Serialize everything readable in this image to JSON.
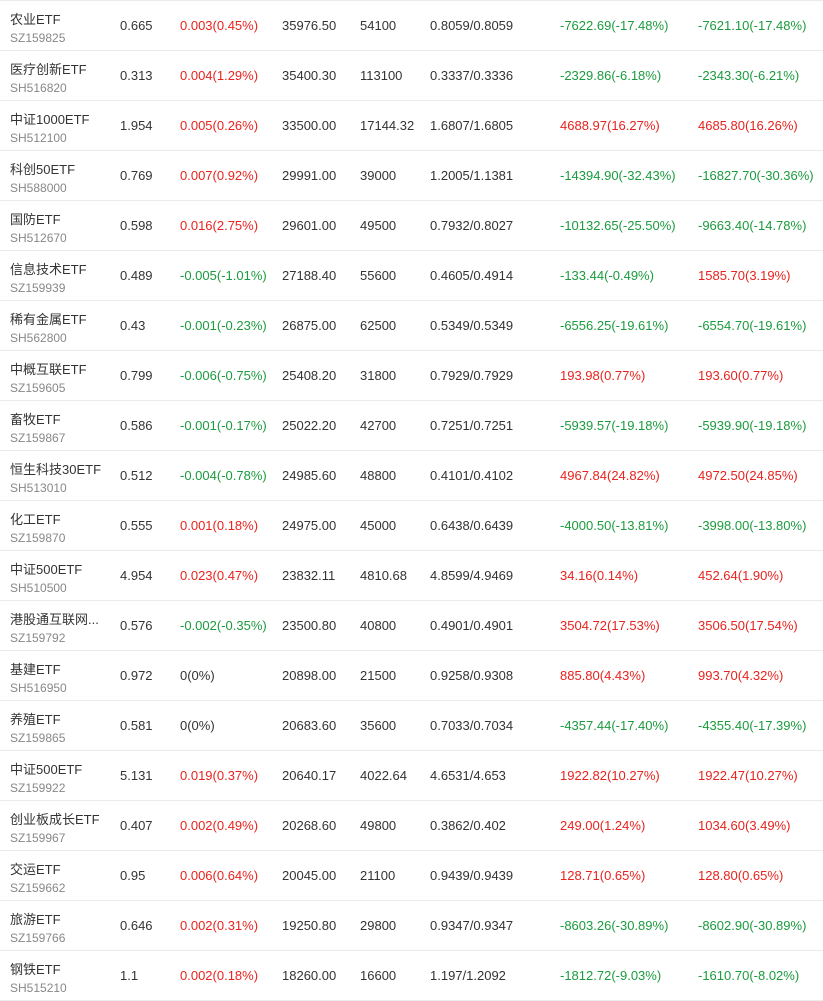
{
  "colors": {
    "up": "#e8231e",
    "down": "#1b9b3e",
    "flat": "#333333",
    "divider": "#ebebeb",
    "code": "#888888"
  },
  "rows": [
    {
      "name": "农业ETF",
      "code": "SZ159825",
      "price": "0.665",
      "change": "0.003(0.45%)",
      "dir": "up",
      "amount": "35976.50",
      "volume": "54100",
      "bid_ask": "0.8059/0.8059",
      "pl1": "-7622.69(-17.48%)",
      "pl1_dir": "down",
      "pl2": "-7621.10(-17.48%)",
      "pl2_dir": "down"
    },
    {
      "name": "医疗创新ETF",
      "code": "SH516820",
      "price": "0.313",
      "change": "0.004(1.29%)",
      "dir": "up",
      "amount": "35400.30",
      "volume": "113100",
      "bid_ask": "0.3337/0.3336",
      "pl1": "-2329.86(-6.18%)",
      "pl1_dir": "down",
      "pl2": "-2343.30(-6.21%)",
      "pl2_dir": "down"
    },
    {
      "name": "中证1000ETF",
      "code": "SH512100",
      "price": "1.954",
      "change": "0.005(0.26%)",
      "dir": "up",
      "amount": "33500.00",
      "volume": "17144.32",
      "bid_ask": "1.6807/1.6805",
      "pl1": "4688.97(16.27%)",
      "pl1_dir": "up",
      "pl2": "4685.80(16.26%)",
      "pl2_dir": "up"
    },
    {
      "name": "科创50ETF",
      "code": "SH588000",
      "price": "0.769",
      "change": "0.007(0.92%)",
      "dir": "up",
      "amount": "29991.00",
      "volume": "39000",
      "bid_ask": "1.2005/1.1381",
      "pl1": "-14394.90(-32.43%)",
      "pl1_dir": "down",
      "pl2": "-16827.70(-30.36%)",
      "pl2_dir": "down"
    },
    {
      "name": "国防ETF",
      "code": "SH512670",
      "price": "0.598",
      "change": "0.016(2.75%)",
      "dir": "up",
      "amount": "29601.00",
      "volume": "49500",
      "bid_ask": "0.7932/0.8027",
      "pl1": "-10132.65(-25.50%)",
      "pl1_dir": "down",
      "pl2": "-9663.40(-14.78%)",
      "pl2_dir": "down"
    },
    {
      "name": "信息技术ETF",
      "code": "SZ159939",
      "price": "0.489",
      "change": "-0.005(-1.01%)",
      "dir": "down",
      "amount": "27188.40",
      "volume": "55600",
      "bid_ask": "0.4605/0.4914",
      "pl1": "-133.44(-0.49%)",
      "pl1_dir": "down",
      "pl2": "1585.70(3.19%)",
      "pl2_dir": "up"
    },
    {
      "name": "稀有金属ETF",
      "code": "SH562800",
      "price": "0.43",
      "change": "-0.001(-0.23%)",
      "dir": "down",
      "amount": "26875.00",
      "volume": "62500",
      "bid_ask": "0.5349/0.5349",
      "pl1": "-6556.25(-19.61%)",
      "pl1_dir": "down",
      "pl2": "-6554.70(-19.61%)",
      "pl2_dir": "down"
    },
    {
      "name": "中概互联ETF",
      "code": "SZ159605",
      "price": "0.799",
      "change": "-0.006(-0.75%)",
      "dir": "down",
      "amount": "25408.20",
      "volume": "31800",
      "bid_ask": "0.7929/0.7929",
      "pl1": "193.98(0.77%)",
      "pl1_dir": "up",
      "pl2": "193.60(0.77%)",
      "pl2_dir": "up"
    },
    {
      "name": "畜牧ETF",
      "code": "SZ159867",
      "price": "0.586",
      "change": "-0.001(-0.17%)",
      "dir": "down",
      "amount": "25022.20",
      "volume": "42700",
      "bid_ask": "0.7251/0.7251",
      "pl1": "-5939.57(-19.18%)",
      "pl1_dir": "down",
      "pl2": "-5939.90(-19.18%)",
      "pl2_dir": "down"
    },
    {
      "name": "恒生科技30ETF",
      "code": "SH513010",
      "price": "0.512",
      "change": "-0.004(-0.78%)",
      "dir": "down",
      "amount": "24985.60",
      "volume": "48800",
      "bid_ask": "0.4101/0.4102",
      "pl1": "4967.84(24.82%)",
      "pl1_dir": "up",
      "pl2": "4972.50(24.85%)",
      "pl2_dir": "up"
    },
    {
      "name": "化工ETF",
      "code": "SZ159870",
      "price": "0.555",
      "change": "0.001(0.18%)",
      "dir": "up",
      "amount": "24975.00",
      "volume": "45000",
      "bid_ask": "0.6438/0.6439",
      "pl1": "-4000.50(-13.81%)",
      "pl1_dir": "down",
      "pl2": "-3998.00(-13.80%)",
      "pl2_dir": "down"
    },
    {
      "name": "中证500ETF",
      "code": "SH510500",
      "price": "4.954",
      "change": "0.023(0.47%)",
      "dir": "up",
      "amount": "23832.11",
      "volume": "4810.68",
      "bid_ask": "4.8599/4.9469",
      "pl1": "34.16(0.14%)",
      "pl1_dir": "up",
      "pl2": "452.64(1.90%)",
      "pl2_dir": "up"
    },
    {
      "name": "港股通互联网...",
      "code": "SZ159792",
      "price": "0.576",
      "change": "-0.002(-0.35%)",
      "dir": "down",
      "amount": "23500.80",
      "volume": "40800",
      "bid_ask": "0.4901/0.4901",
      "pl1": "3504.72(17.53%)",
      "pl1_dir": "up",
      "pl2": "3506.50(17.54%)",
      "pl2_dir": "up"
    },
    {
      "name": "基建ETF",
      "code": "SH516950",
      "price": "0.972",
      "change": "0(0%)",
      "dir": "flat",
      "amount": "20898.00",
      "volume": "21500",
      "bid_ask": "0.9258/0.9308",
      "pl1": "885.80(4.43%)",
      "pl1_dir": "up",
      "pl2": "993.70(4.32%)",
      "pl2_dir": "up"
    },
    {
      "name": "养殖ETF",
      "code": "SZ159865",
      "price": "0.581",
      "change": "0(0%)",
      "dir": "flat",
      "amount": "20683.60",
      "volume": "35600",
      "bid_ask": "0.7033/0.7034",
      "pl1": "-4357.44(-17.40%)",
      "pl1_dir": "down",
      "pl2": "-4355.40(-17.39%)",
      "pl2_dir": "down"
    },
    {
      "name": "中证500ETF",
      "code": "SZ159922",
      "price": "5.131",
      "change": "0.019(0.37%)",
      "dir": "up",
      "amount": "20640.17",
      "volume": "4022.64",
      "bid_ask": "4.6531/4.653",
      "pl1": "1922.82(10.27%)",
      "pl1_dir": "up",
      "pl2": "1922.47(10.27%)",
      "pl2_dir": "up"
    },
    {
      "name": "创业板成长ETF",
      "code": "SZ159967",
      "price": "0.407",
      "change": "0.002(0.49%)",
      "dir": "up",
      "amount": "20268.60",
      "volume": "49800",
      "bid_ask": "0.3862/0.402",
      "pl1": "249.00(1.24%)",
      "pl1_dir": "up",
      "pl2": "1034.60(3.49%)",
      "pl2_dir": "up"
    },
    {
      "name": "交运ETF",
      "code": "SZ159662",
      "price": "0.95",
      "change": "0.006(0.64%)",
      "dir": "up",
      "amount": "20045.00",
      "volume": "21100",
      "bid_ask": "0.9439/0.9439",
      "pl1": "128.71(0.65%)",
      "pl1_dir": "up",
      "pl2": "128.80(0.65%)",
      "pl2_dir": "up"
    },
    {
      "name": "旅游ETF",
      "code": "SZ159766",
      "price": "0.646",
      "change": "0.002(0.31%)",
      "dir": "up",
      "amount": "19250.80",
      "volume": "29800",
      "bid_ask": "0.9347/0.9347",
      "pl1": "-8603.26(-30.89%)",
      "pl1_dir": "down",
      "pl2": "-8602.90(-30.89%)",
      "pl2_dir": "down"
    },
    {
      "name": "钢铁ETF",
      "code": "SH515210",
      "price": "1.1",
      "change": "0.002(0.18%)",
      "dir": "up",
      "amount": "18260.00",
      "volume": "16600",
      "bid_ask": "1.197/1.2092",
      "pl1": "-1812.72(-9.03%)",
      "pl1_dir": "down",
      "pl2": "-1610.70(-8.02%)",
      "pl2_dir": "down"
    }
  ]
}
